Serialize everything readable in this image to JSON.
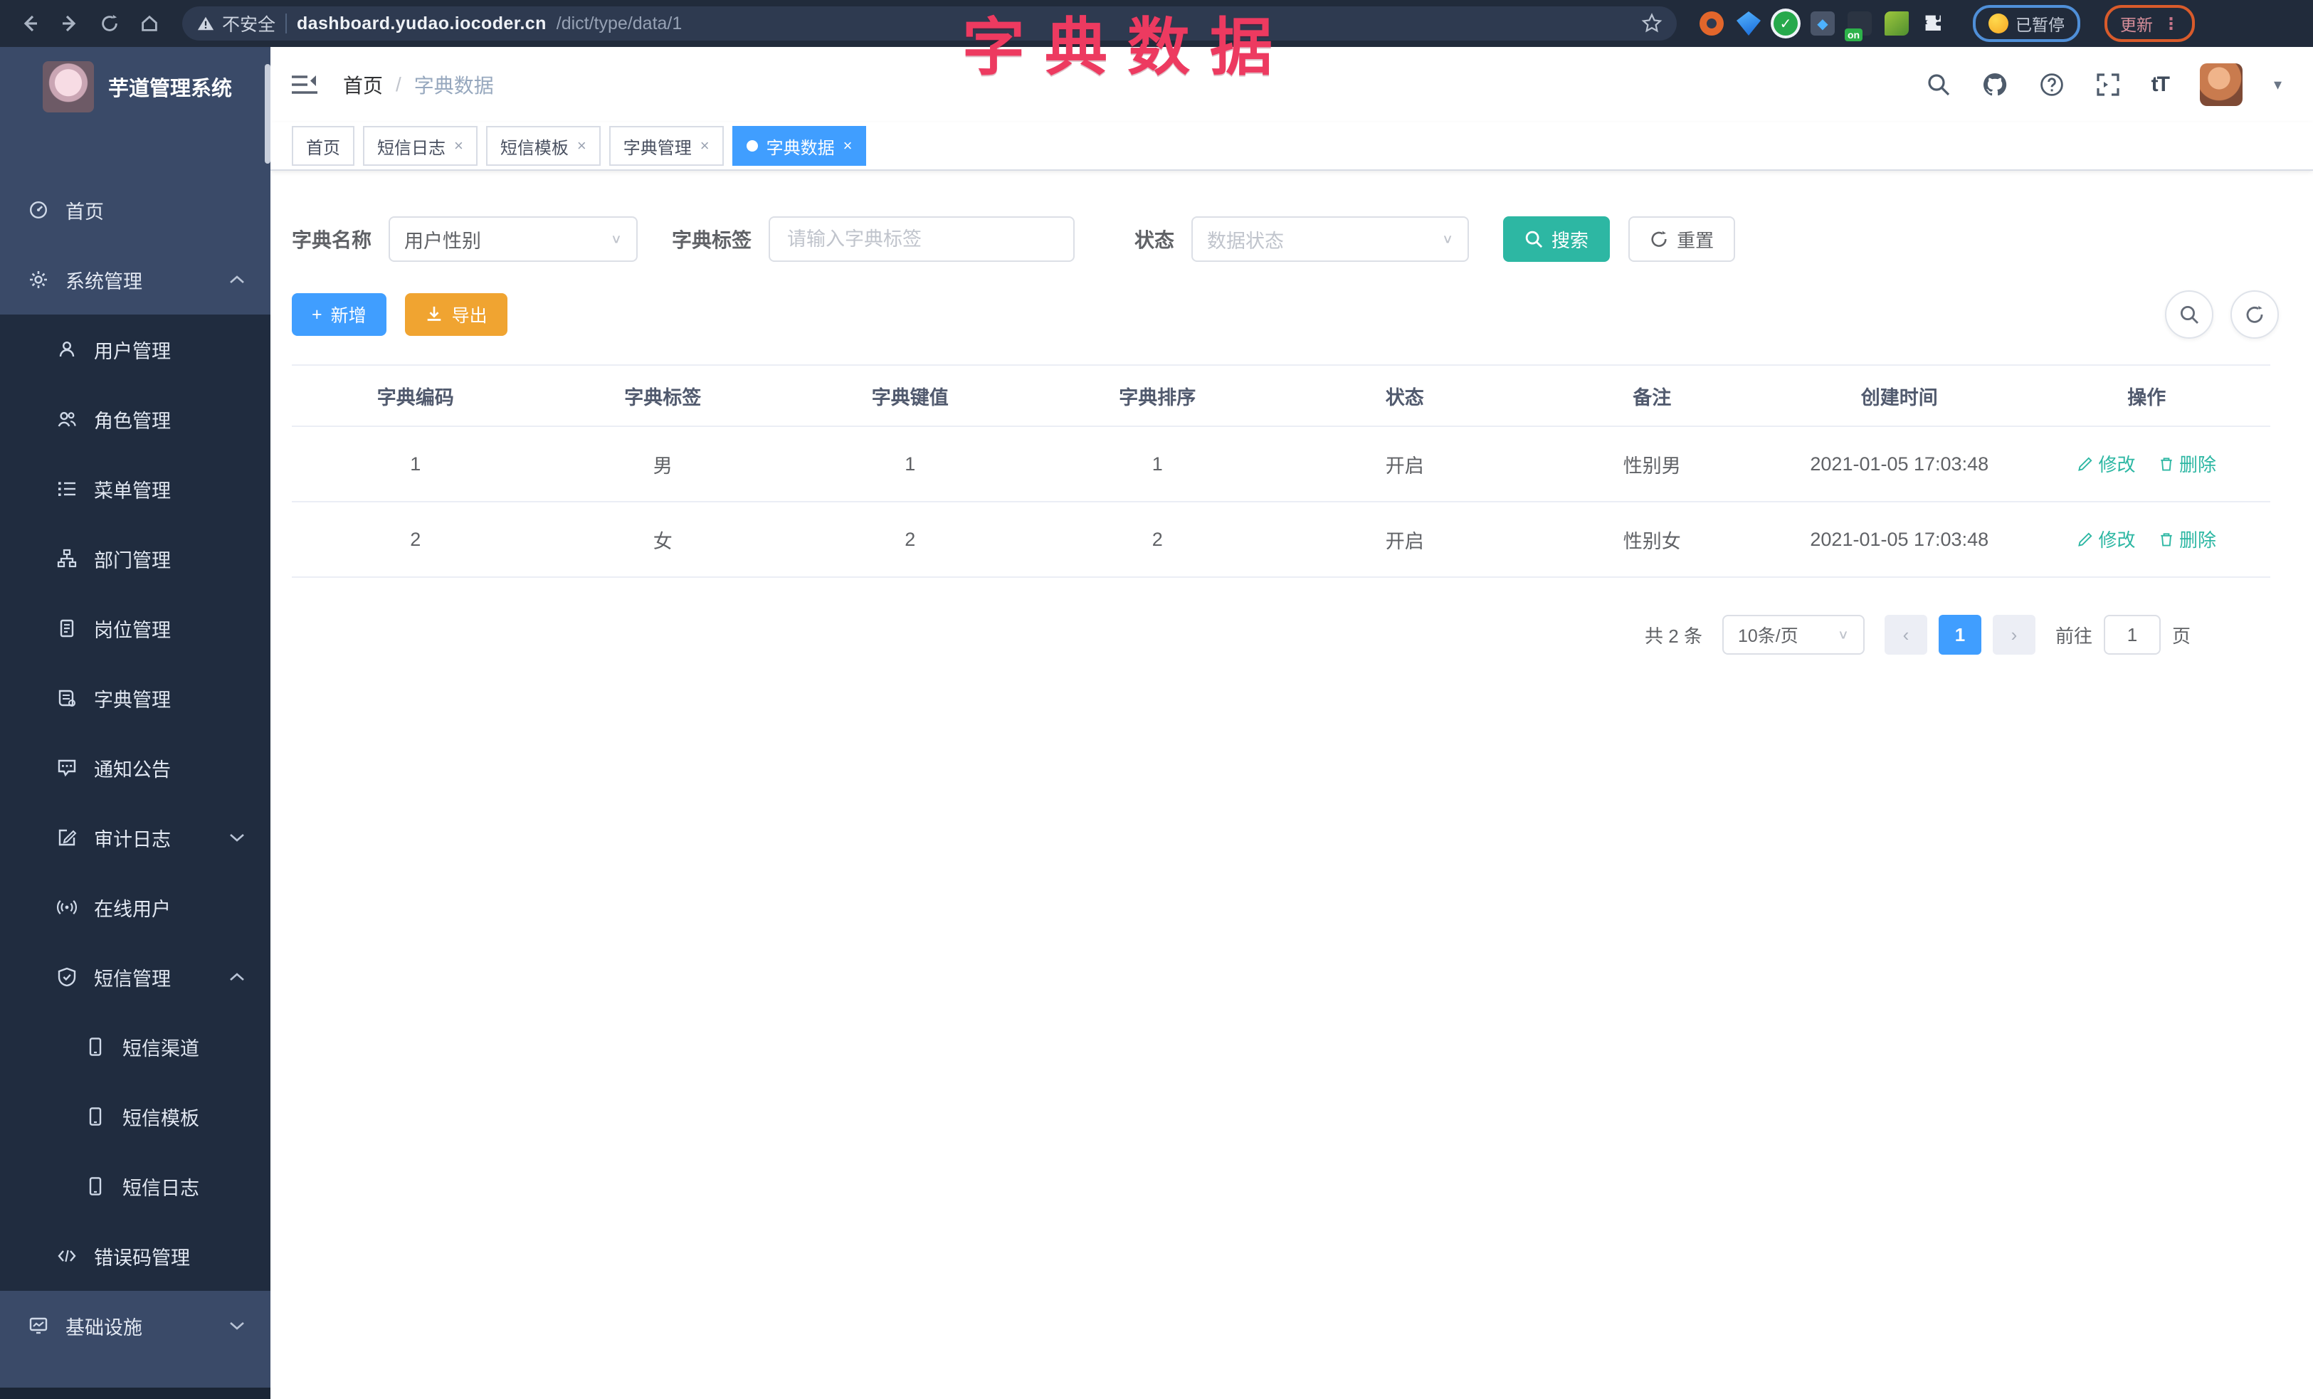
{
  "annotation": {
    "text": "字典数据"
  },
  "browser": {
    "security_label": "不安全",
    "url_host": "dashboard.yudao.iocoder.cn",
    "url_path": "/dict/type/data/1",
    "on_badge": "on",
    "paused_label": "已暂停",
    "update_label": "更新",
    "kebab": "⋮"
  },
  "sidebar": {
    "title": "芋道管理系统",
    "items": [
      {
        "label": "首页"
      },
      {
        "label": "系统管理"
      },
      {
        "label": "用户管理"
      },
      {
        "label": "角色管理"
      },
      {
        "label": "菜单管理"
      },
      {
        "label": "部门管理"
      },
      {
        "label": "岗位管理"
      },
      {
        "label": "字典管理"
      },
      {
        "label": "通知公告"
      },
      {
        "label": "审计日志"
      },
      {
        "label": "在线用户"
      },
      {
        "label": "短信管理"
      },
      {
        "label": "短信渠道"
      },
      {
        "label": "短信模板"
      },
      {
        "label": "短信日志"
      },
      {
        "label": "错误码管理"
      },
      {
        "label": "基础设施"
      }
    ]
  },
  "header": {
    "breadcrumb_home": "首页",
    "breadcrumb_sep": "/",
    "breadcrumb_current": "字典数据",
    "font_size_icon": "tT",
    "caret": "▾"
  },
  "tabs": [
    {
      "label": "首页"
    },
    {
      "label": "短信日志"
    },
    {
      "label": "短信模板"
    },
    {
      "label": "字典管理"
    },
    {
      "label": "字典数据"
    }
  ],
  "tab_close": "×",
  "filters": {
    "name_label": "字典名称",
    "name_value": "用户性别",
    "tag_label": "字典标签",
    "tag_placeholder": "请输入字典标签",
    "status_label": "状态",
    "status_placeholder": "数据状态",
    "search_label": "搜索",
    "reset_label": "重置",
    "dropdown_arrow": "∨"
  },
  "actions": {
    "add_label": "新增",
    "add_plus": "+",
    "export_label": "导出"
  },
  "table": {
    "columns": [
      "字典编码",
      "字典标签",
      "字典键值",
      "字典排序",
      "状态",
      "备注",
      "创建时间",
      "操作"
    ],
    "rows": [
      {
        "code": "1",
        "label": "男",
        "value": "1",
        "sort": "1",
        "status": "开启",
        "remark": "性别男",
        "created": "2021-01-05 17:03:48"
      },
      {
        "code": "2",
        "label": "女",
        "value": "2",
        "sort": "2",
        "status": "开启",
        "remark": "性别女",
        "created": "2021-01-05 17:03:48"
      }
    ],
    "ops": {
      "edit": "修改",
      "delete": "删除"
    }
  },
  "pagination": {
    "total": "共 2 条",
    "page_size": "10条/页",
    "prev": "‹",
    "page": "1",
    "next": "›",
    "goto_label": "前往",
    "goto_value": "1",
    "page_suffix": "页",
    "dropdown_arrow": "∨"
  },
  "colors": {
    "primary": "#409eff",
    "teal": "#2db7a3",
    "warning": "#f0a431",
    "annotation_pink": "#ed3a60",
    "sidebar_bg": "#3a4a68",
    "sidebar_submenu_bg": "#202c3f",
    "browser_bar_bg": "#212b3b"
  }
}
